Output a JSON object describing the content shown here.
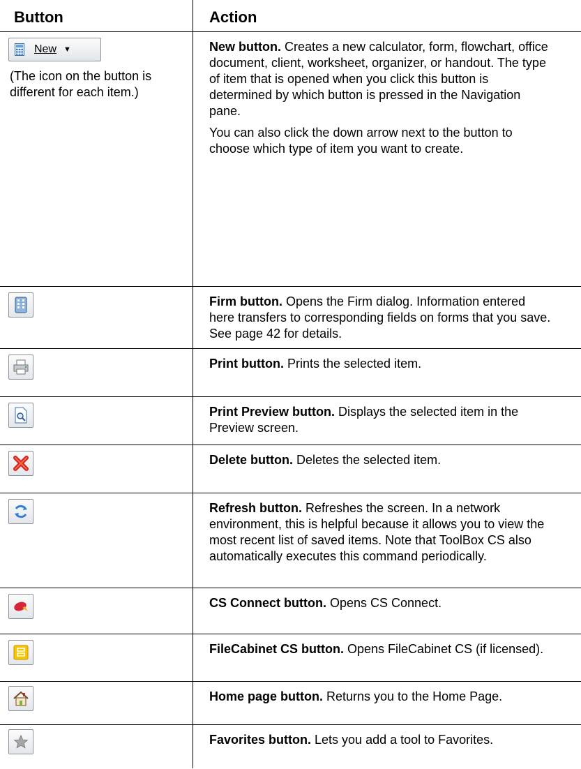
{
  "header": {
    "button_col": "Button",
    "action_col": "Action"
  },
  "rows": [
    {
      "button_label": "New",
      "note": "(The icon on the button is different for each item.)",
      "title": "New button.",
      "text": " Creates a new calculator, form, flowchart, office document, client, worksheet, organizer, or handout. The type of item that is opened when you click this button is determined by which button is pressed in the Navigation pane.",
      "text2": "You can also click the down arrow next to the button to choose which type of item you want to create."
    },
    {
      "title": "Firm button.",
      "text": " Opens the Firm dialog. Information entered here transfers to corresponding fields on forms that you save. See page 42 for details."
    },
    {
      "title": "Print button.",
      "text": " Prints the selected item."
    },
    {
      "title": "Print Preview button.",
      "text": " Displays the selected item in the Preview screen."
    },
    {
      "title": "Delete button.",
      "text": " Deletes the selected item."
    },
    {
      "title": "Refresh button.",
      "text": " Refreshes the screen. In a network environment, this is helpful because it allows you to view the most recent list of saved items. Note that ToolBox CS also automatically executes this command periodically."
    },
    {
      "title": "CS Connect button.",
      "text": " Opens CS Connect."
    },
    {
      "title": "FileCabinet CS button.",
      "text": " Opens FileCabinet CS (if licensed)."
    },
    {
      "title": "Home page button.",
      "text": " Returns you to the Home Page."
    },
    {
      "title": "Favorites button.",
      "text": " Lets you add a tool to Favorites."
    }
  ],
  "icons": [
    "calculator-icon",
    "firm-icon",
    "print-icon",
    "print-preview-icon",
    "delete-icon",
    "refresh-icon",
    "cs-connect-icon",
    "filecabinet-icon",
    "home-icon",
    "favorites-icon"
  ]
}
